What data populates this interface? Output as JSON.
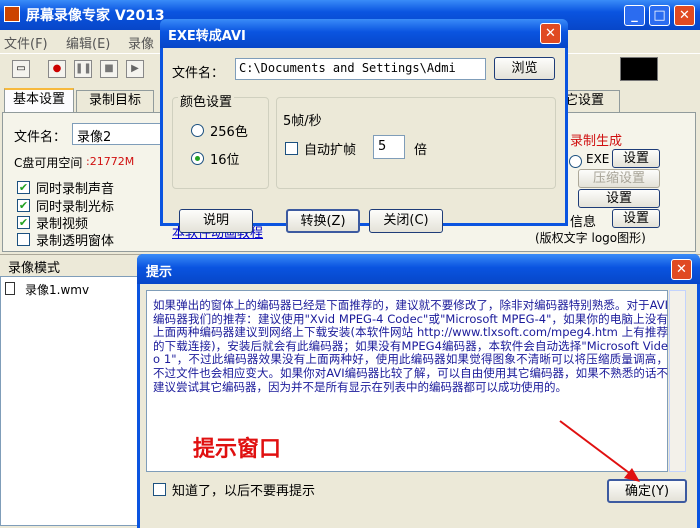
{
  "main_window": {
    "title": "屏幕录像专家  V2013",
    "menu": [
      "文件(F)",
      "编辑(E)",
      "录像"
    ],
    "tabs": [
      "基本设置",
      "录制目标",
      "它设置"
    ],
    "filename_label": "文件名：",
    "filename_value": "录像2",
    "disk_space_label": "C盘可用空间",
    "disk_space_value": ":21772M",
    "options": [
      {
        "label": "同时录制声音",
        "checked": true
      },
      {
        "label": "同时录制光标",
        "checked": true
      },
      {
        "label": "录制视频",
        "checked": true
      },
      {
        "label": "录制透明窗体",
        "checked": false
      }
    ],
    "tutorial_link": "本软件动画教程",
    "mode_header": "录像模式",
    "file_list": [
      "录像1.wmv"
    ],
    "right_panel": {
      "record_generate": "录制生成",
      "exe_label": "EXE",
      "settings_btn": "设置",
      "compress_btn": "压缩设置",
      "info_label": "信息",
      "copyright_text": "(版权文字 logo图形)"
    }
  },
  "exe_dialog": {
    "title": "EXE转成AVI",
    "filename_label": "文件名：",
    "filename_value": "C:\\Documents and Settings\\Admi",
    "browse_btn": "浏览",
    "color_group_label": "颜色设置",
    "color_options": [
      {
        "label": "256色",
        "selected": false
      },
      {
        "label": "16位",
        "selected": true
      }
    ],
    "fps_label": "5帧/秒",
    "auto_expand_label": "自动扩帧",
    "multiplier_value": "5",
    "times_label": "倍",
    "explain_btn": "说明",
    "convert_btn": "转换(Z)",
    "close_btn": "关闭(C)"
  },
  "hint_dialog": {
    "title": "提示",
    "message": "如果弹出的窗体上的编码器已经是下面推荐的，建议就不要修改了，除非对编码器特别熟悉。对于AVI编码器我们的推荐：建议使用\"Xvid MPEG-4 Codec\"或\"Microsoft MPEG-4\"，如果你的电脑上没有上面两种编码器建议到网络上下载安装(本软件网站 http://www.tlxsoft.com/mpeg4.htm 上有推荐的下载连接)，安装后就会有此编码器；如果没有MPEG4编码器，本软件会自动选择\"Microsoft Video 1\"，不过此编码器效果没有上面两种好，使用此编码器如果觉得图象不清晰可以将压缩质量调高，不过文件也会相应变大。如果你对AVI编码器比较了解，可以自由使用其它编码器，如果不熟悉的话不建议尝试其它编码器，因为并不是所有显示在列表中的编码器都可以成功使用的。",
    "annotation": "提示窗口",
    "dont_show_label": "知道了，以后不要再提示",
    "ok_btn": "确定(Y)"
  },
  "colors": {
    "xp_title_blue": "#0a54e0",
    "annotation_red": "#e01010",
    "disk_space_red": "#d01010",
    "link_blue": "#0000cc"
  }
}
